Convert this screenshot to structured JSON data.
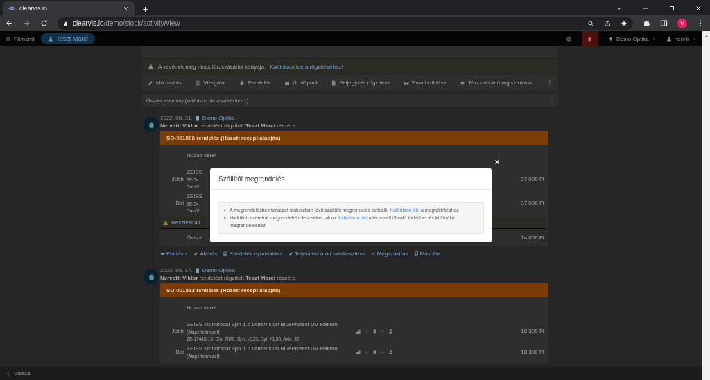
{
  "browser": {
    "tab_title": "clearvis.io",
    "url_host": "clearvis.io",
    "url_path": "/demo/stock/activity/view",
    "profile_initial": "V"
  },
  "navbar": {
    "menu_label": "Főmenü",
    "customer": "Teszt Marci",
    "store": "Demo Optika",
    "user": "nervik"
  },
  "notice": {
    "text": "A vevőnek még nincs törzsvásárlói kártyája.",
    "link": "Kattintson ide a rögzítéséhez!"
  },
  "toolbar": [
    "Módosítás",
    "Vizsgálat",
    "Rendelés",
    "Új időpont",
    "Feljegyzés rögzítése",
    "Email küldése",
    "Törzsvásárló regisztrálása"
  ],
  "filter": {
    "text": "Összes esemény (kattintson ide a szűréshez...)"
  },
  "events": [
    {
      "date": "2022. 08. 31.",
      "store": "Demo Optika",
      "sentence": "**Nervetti Viktor** rendelést rögzített **Teszt Marci** részére.",
      "order_title": "SO-001566 rendelés (Hozott recept alapján)",
      "frame_label": "Hozott keret",
      "lines": [
        {
          "kind": "partial",
          "side": "Jobb",
          "name": "ZEISS",
          "option": "ZE-34",
          "code": "DuraV",
          "price": "37 000 Ft"
        },
        {
          "kind": "partial",
          "side": "Bal",
          "name": "ZEISS",
          "option": "ZE-34",
          "code": "DuraV",
          "price": "37 000 Ft"
        }
      ],
      "warning": "Illesztési ad",
      "total_label": "Össze",
      "total": "74 000 Ft",
      "actions": [
        "Eladás",
        "Aláírás",
        "Rendelés nyomtatása",
        "Teljesítési mód szerkesztése",
        "Megszakítás",
        "Másolás"
      ]
    },
    {
      "date": "2022. 08. 17.",
      "store": "Demo Optika",
      "sentence": "**Nervetti Viktor** rendelést rögzített **Teszt Marci** részére.",
      "order_title": "SO-001512 rendelés (Hozott recept alapján)",
      "frame_label": "Hozott keret",
      "lines": [
        {
          "kind": "full",
          "side": "Jobb",
          "name": "ZEISS Monofocal Sph 1.5 DuraVision BlueProtect UV Raktári",
          "option": "(Alapértelmezett)",
          "code": "ZE-17445-15, Dia: 7070, Sph: -2.25, Cyl: +1.50, Axis: 30",
          "price": "18 300 Ft"
        },
        {
          "kind": "full",
          "side": "Bal",
          "name": "ZEISS Monofocal Sph 1.5 DuraVision BlueProtect UV Raktári",
          "option": "(Alapértelmezett)",
          "price": "18 300 Ft"
        }
      ]
    }
  ],
  "modal": {
    "title": "Szállítói megrendelés",
    "items": [
      {
        "bullet": "•",
        "before": "A megrendeléshez tervezet státuszban lévő szállítói megrendelés tartozik. ",
        "link": "Kattintson ide",
        "after": " a megtekintéshez"
      },
      {
        "bullet": "•",
        "before": "Ha külön szeretné megrendelni a lencséket, akkor ",
        "link": "kattintson ide",
        "after": " a tervezetből való törléshez és különálló megrendeléshez"
      }
    ]
  },
  "footer": {
    "back": "Vissza"
  }
}
